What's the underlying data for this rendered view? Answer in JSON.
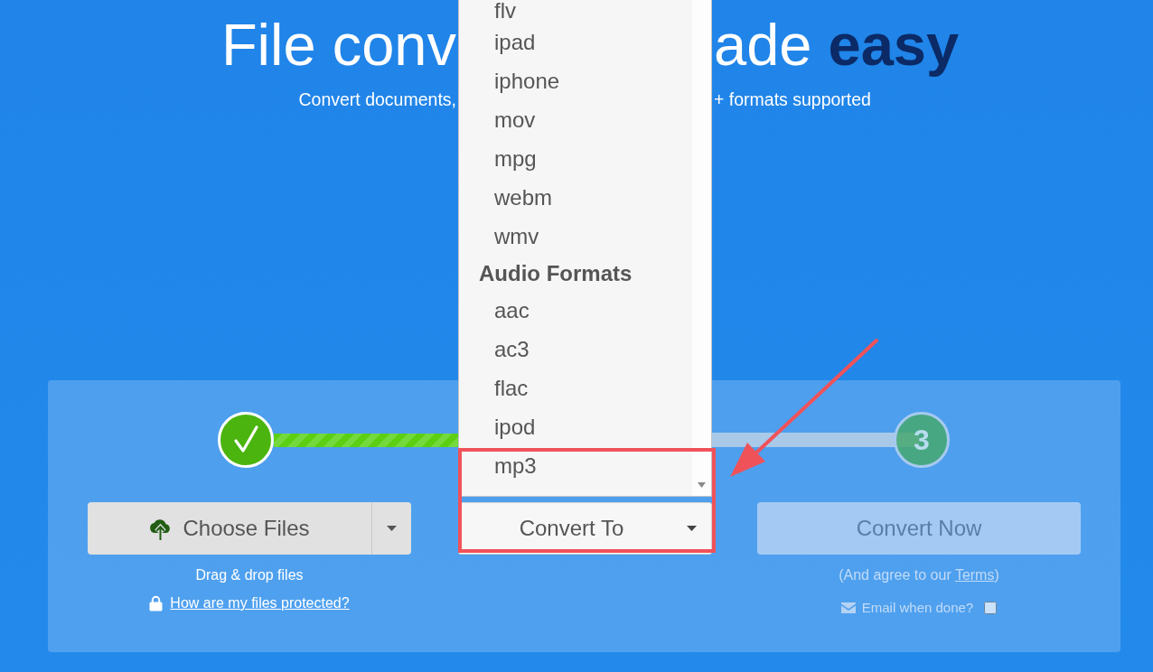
{
  "hero": {
    "title_left": "File conv",
    "title_right": "ade **easy**",
    "subtitle_left": "Convert documents,",
    "subtitle_right": "+ formats supported"
  },
  "steps": [
    {
      "done": true
    },
    {
      "label": "3",
      "done": false
    }
  ],
  "upload": {
    "button": "Choose Files",
    "hint": "Drag & drop files",
    "security_link": "How are my files protected?"
  },
  "format_select": {
    "label": "Convert To",
    "expanded": true,
    "groups": [
      {
        "items": [
          "flv",
          "ipad",
          "iphone",
          "mov",
          "mpg",
          "webm",
          "wmv"
        ]
      },
      {
        "heading": "Audio Formats",
        "items": [
          "aac",
          "ac3",
          "flac",
          "ipod",
          "mp3"
        ]
      }
    ]
  },
  "convert": {
    "button": "Convert Now",
    "disabled": true,
    "terms_before": "(And agree to our ",
    "terms_link": "Terms",
    "terms_after": ")",
    "email_label": "Email when done?",
    "email_checked": false
  }
}
